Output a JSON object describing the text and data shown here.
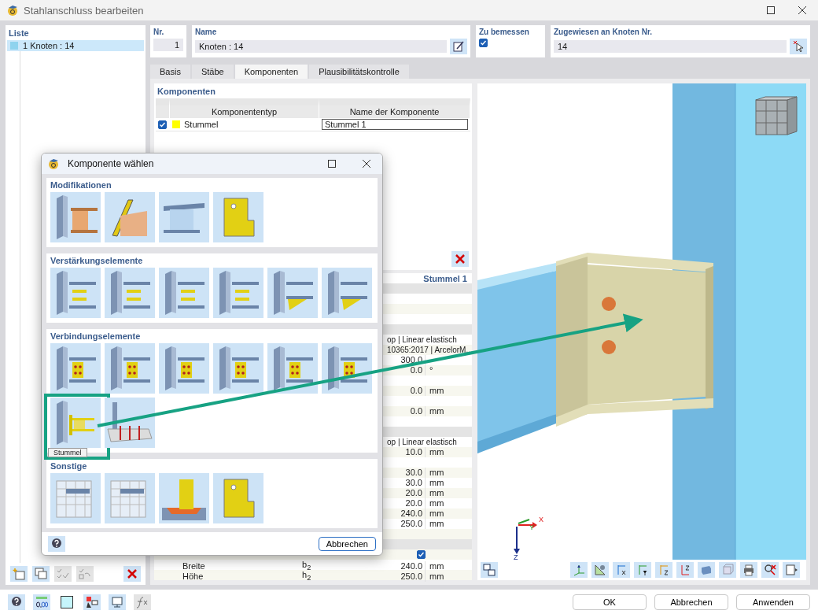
{
  "window": {
    "title": "Stahlanschluss bearbeiten"
  },
  "list": {
    "title": "Liste",
    "items": [
      {
        "number": "1",
        "label": "Knoten : 14",
        "color": "#8fd3ee",
        "selected": true
      }
    ]
  },
  "header": {
    "number": {
      "label": "Nr.",
      "value": "1"
    },
    "name": {
      "label": "Name",
      "value": "Knoten : 14"
    },
    "design": {
      "label": "Zu bemessen",
      "checked": true
    },
    "assigned": {
      "label": "Zugewiesen an Knoten Nr.",
      "value": "14"
    }
  },
  "tabs": [
    {
      "label": "Basis",
      "selected": false
    },
    {
      "label": "Stäbe",
      "selected": false
    },
    {
      "label": "Komponenten",
      "selected": true
    },
    {
      "label": "Plausibilitätskontrolle",
      "selected": false
    }
  ],
  "components": {
    "title": "Komponenten",
    "columns": [
      "Komponententyp",
      "Name der Komponente"
    ],
    "rows": [
      {
        "checked": true,
        "color": "#ffff00",
        "type": "Stummel",
        "name": "Stummel 1"
      }
    ]
  },
  "properties": {
    "title": "Stummel 1",
    "rows": [
      {
        "kind": "section"
      },
      {
        "kind": "blank"
      },
      {
        "kind": "blank"
      },
      {
        "kind": "blank"
      },
      {
        "kind": "section"
      },
      {
        "kind": "text",
        "text": "op | Linear elastisch"
      },
      {
        "kind": "text",
        "text": "10365:2017 | ArcelorM..."
      },
      {
        "kind": "value",
        "value": "300.0"
      },
      {
        "kind": "value",
        "value": "0.0",
        "unit": "°"
      },
      {
        "kind": "blank"
      },
      {
        "kind": "value",
        "value": "0.0",
        "unit": "mm"
      },
      {
        "kind": "blank"
      },
      {
        "kind": "value",
        "value": "0.0",
        "unit": "mm"
      },
      {
        "kind": "blank"
      },
      {
        "kind": "section"
      },
      {
        "kind": "text",
        "text": "op | Linear elastisch"
      },
      {
        "kind": "value",
        "value": "10.0",
        "unit": "mm"
      },
      {
        "kind": "blank"
      },
      {
        "kind": "value",
        "value": "30.0",
        "unit": "mm"
      },
      {
        "kind": "value",
        "value": "30.0",
        "unit": "mm"
      },
      {
        "kind": "value",
        "value": "20.0",
        "unit": "mm"
      },
      {
        "kind": "value",
        "value": "20.0",
        "unit": "mm"
      },
      {
        "kind": "value",
        "value": "240.0",
        "unit": "mm"
      },
      {
        "kind": "value",
        "value": "250.0",
        "unit": "mm"
      },
      {
        "kind": "blank"
      },
      {
        "kind": "section"
      },
      {
        "kind": "check",
        "checked": true
      },
      {
        "kind": "param",
        "label": "Breite",
        "symbol": "b$_{2}$",
        "value": "240.0",
        "unit": "mm"
      },
      {
        "kind": "param",
        "label": "Höhe",
        "symbol": "h$_{2}$",
        "value": "250.0",
        "unit": "mm"
      }
    ]
  },
  "view": {
    "axis_labels": {
      "x": "X",
      "y": "Y",
      "z": "Z"
    }
  },
  "dialog": {
    "title": "Komponente wählen",
    "groups": [
      {
        "title": "Modifikationen",
        "tiles": [
          {
            "kind": "end-plate",
            "selected": false
          },
          {
            "kind": "cut-plate",
            "selected": false
          },
          {
            "kind": "notch",
            "selected": false
          },
          {
            "kind": "flat-plate",
            "selected": false
          }
        ]
      },
      {
        "title": "Verstärkungselemente",
        "tiles": [
          {
            "kind": "stiffener",
            "selected": false
          },
          {
            "kind": "stiffener",
            "selected": false
          },
          {
            "kind": "stiffener",
            "selected": false
          },
          {
            "kind": "stiffener",
            "selected": false
          },
          {
            "kind": "haunch",
            "selected": false
          },
          {
            "kind": "haunch",
            "selected": false
          }
        ]
      },
      {
        "title": "Verbindungselemente",
        "tiles": [
          {
            "kind": "bolted",
            "selected": false
          },
          {
            "kind": "bolted",
            "selected": false
          },
          {
            "kind": "bolted",
            "selected": false
          },
          {
            "kind": "bolted",
            "selected": false
          },
          {
            "kind": "bolted",
            "selected": false
          },
          {
            "kind": "bolted",
            "selected": false
          },
          {
            "kind": "stub",
            "selected": true,
            "tooltip": "Stummel"
          },
          {
            "kind": "anchor",
            "selected": false
          }
        ]
      },
      {
        "title": "Sonstige",
        "tiles": [
          {
            "kind": "mesh",
            "selected": false
          },
          {
            "kind": "mesh",
            "selected": false
          },
          {
            "kind": "weld",
            "selected": false
          },
          {
            "kind": "flat-plate",
            "selected": false
          }
        ]
      }
    ],
    "cancel": "Abbrechen"
  },
  "buttons": [
    "OK",
    "Abbrechen",
    "Anwenden"
  ]
}
